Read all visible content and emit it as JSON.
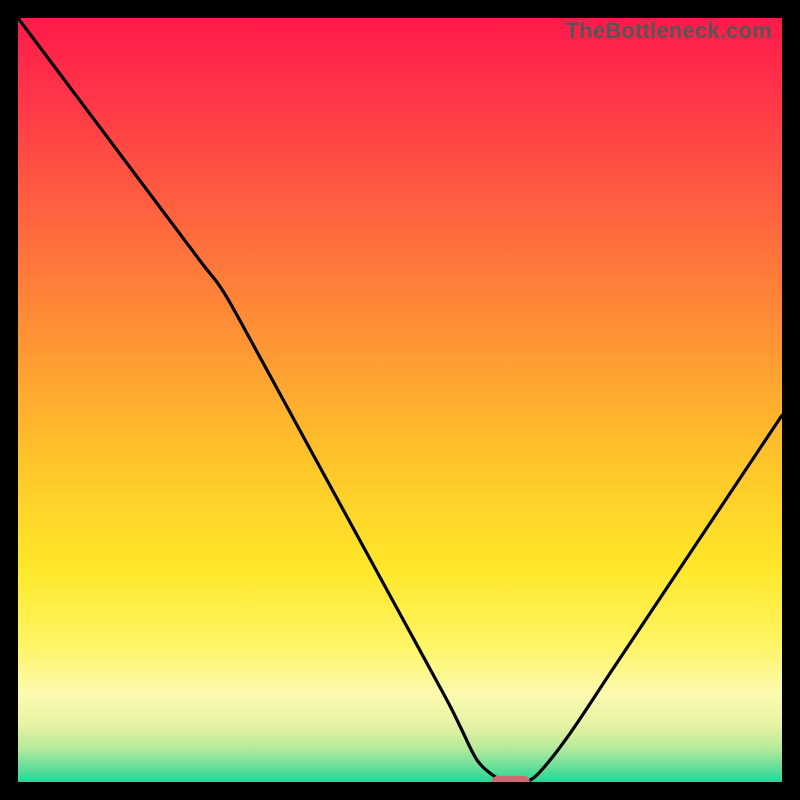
{
  "watermark": {
    "text": "TheBottleneck.com"
  },
  "chart_data": {
    "type": "line",
    "title": "",
    "xlabel": "",
    "ylabel": "",
    "xlim": [
      0,
      100
    ],
    "ylim": [
      0,
      100
    ],
    "grid": false,
    "legend": false,
    "series": [
      {
        "name": "curve",
        "x": [
          0,
          6,
          12,
          18,
          24,
          27,
          32,
          38,
          44,
          50,
          56,
          58,
          60,
          62,
          64,
          66,
          68,
          72,
          78,
          84,
          90,
          96,
          100
        ],
        "y": [
          100,
          92,
          84,
          76,
          68,
          64,
          55,
          44,
          33,
          22,
          11,
          7,
          3,
          1,
          0,
          0,
          1,
          6,
          15,
          24,
          33,
          42,
          48
        ]
      }
    ],
    "marker": {
      "name": "optimal-point",
      "x": 64.5,
      "y": 0,
      "width_pct": 5,
      "height_pct": 1.6,
      "color": "#cc6a72"
    },
    "background_gradient": {
      "stops": [
        {
          "offset": 0.0,
          "color": "#ff1a4b"
        },
        {
          "offset": 0.12,
          "color": "#ff3a47"
        },
        {
          "offset": 0.28,
          "color": "#ff6a3e"
        },
        {
          "offset": 0.44,
          "color": "#ff9a33"
        },
        {
          "offset": 0.58,
          "color": "#ffc52a"
        },
        {
          "offset": 0.72,
          "color": "#ffe72a"
        },
        {
          "offset": 0.82,
          "color": "#fff564"
        },
        {
          "offset": 0.885,
          "color": "#fcfab0"
        },
        {
          "offset": 0.925,
          "color": "#e7f3a3"
        },
        {
          "offset": 0.955,
          "color": "#b7ea9a"
        },
        {
          "offset": 0.978,
          "color": "#6fe09a"
        },
        {
          "offset": 1.0,
          "color": "#23d697"
        }
      ]
    }
  }
}
